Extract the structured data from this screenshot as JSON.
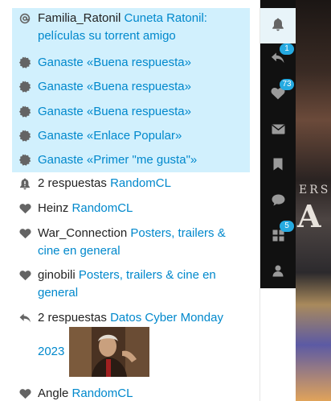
{
  "notifications": [
    {
      "icon": "mention-icon",
      "unread": true,
      "user": "Familia_Ratonil",
      "link": "Cuneta Ratonil: películas su torrent amigo"
    },
    {
      "icon": "badge-icon",
      "unread": true,
      "user": "",
      "link": "Ganaste «Buena respuesta»"
    },
    {
      "icon": "badge-icon",
      "unread": true,
      "user": "",
      "link": "Ganaste «Buena respuesta»"
    },
    {
      "icon": "badge-icon",
      "unread": true,
      "user": "",
      "link": "Ganaste «Buena respuesta»"
    },
    {
      "icon": "badge-icon",
      "unread": true,
      "user": "",
      "link": "Ganaste «Enlace Popular»"
    },
    {
      "icon": "badge-icon",
      "unread": true,
      "user": "",
      "link": "Ganaste «Primer \"me gusta\"»"
    },
    {
      "icon": "bell-icon",
      "unread": false,
      "user": "2 respuestas",
      "link": "RandomCL"
    },
    {
      "icon": "heart-icon",
      "unread": false,
      "user": "Heinz",
      "link": "RandomCL"
    },
    {
      "icon": "heart-icon",
      "unread": false,
      "user": "War_Connection",
      "link": "Posters, trailers & cine en general"
    },
    {
      "icon": "heart-icon",
      "unread": false,
      "user": "ginobili",
      "link": "Posters, trailers & cine en general"
    },
    {
      "icon": "reply-icon",
      "unread": false,
      "user": "2 respuestas",
      "link": "Datos Cyber Monday 2023"
    },
    {
      "icon": "heart-icon",
      "unread": false,
      "user": "Angle",
      "link": "RandomCL"
    }
  ],
  "header": {
    "reply_badge": "1",
    "likes_badge": "73",
    "apps_badge": "5"
  },
  "background": {
    "art_text": "ERSE",
    "art_letter": "A"
  },
  "colors": {
    "unread_bg": "#d1f0fd",
    "link": "#0088cc",
    "header_bg": "#111111",
    "badge": "#25aae1"
  }
}
